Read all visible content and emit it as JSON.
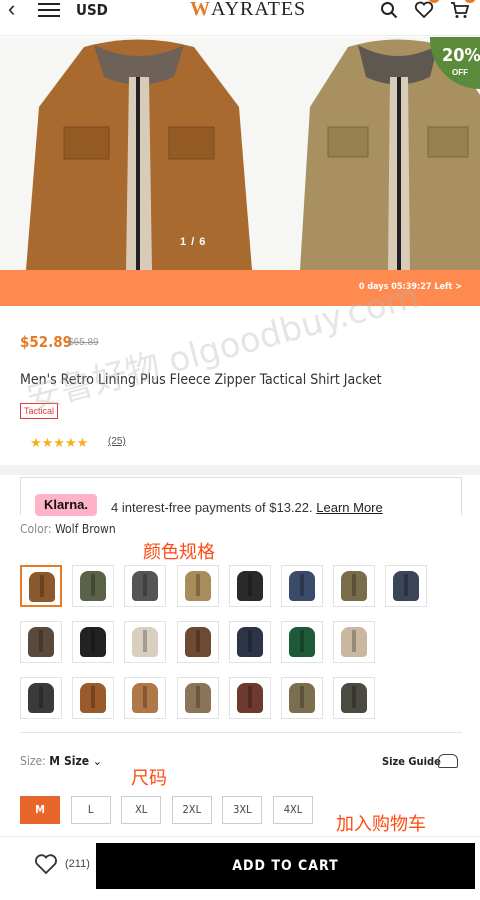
{
  "header": {
    "back_icon": "chevron-left-icon",
    "menu_icon": "hamburger-icon",
    "currency": "USD",
    "logo_text": "AYRATES",
    "logo_initial": "W",
    "icons": [
      "search-icon",
      "heart-icon",
      "cart-icon"
    ]
  },
  "hero": {
    "counter": "1 / 6",
    "discount_pct": "20%",
    "discount_off": "OFF",
    "timer": "0 days 05:39:27 Left  >"
  },
  "product": {
    "price": "$52.89",
    "original_price": "$65.89",
    "title": "Men's Retro Lining Plus Fleece Zipper Tactical Shirt Jacket",
    "tag": "Tactical",
    "rating_stars": 4.5,
    "stars_text": "★★★★★",
    "reviews": "(25)"
  },
  "klarna": {
    "logo": "Klarna.",
    "text": "4 interest-free payments of $13.22.",
    "learn_more": "Learn More"
  },
  "color": {
    "label": "Color:",
    "selected": "Wolf Brown",
    "annotation": "颜色规格",
    "swatches": [
      "#8a5a2e",
      "#5a6348",
      "#555555",
      "#a88c5c",
      "#2a2a2a",
      "#3c4a6a",
      "#7a6e4a",
      "#3a4558",
      "#5a4a3e",
      "#222222",
      "#d8cfc0",
      "#6e4a32",
      "#2e3448",
      "#1f5a38",
      "#c8b8a0",
      "#3a3a3a",
      "#9a5a2a",
      "#b07848",
      "#8c7458",
      "#6e3a2e",
      "#7a7050",
      "#4a4a40"
    ]
  },
  "size": {
    "label": "Size:",
    "selected": "M",
    "dropdown": "Size",
    "guide": "Size Guide",
    "annotation": "尺码",
    "options": [
      "M",
      "L",
      "XL",
      "2XL",
      "3XL",
      "4XL"
    ]
  },
  "cart": {
    "annotation": "加入购物车",
    "wishlist_count": "(211)",
    "button": "ADD TO CART"
  },
  "watermark": "安鲁好物 olgoodbuy.com"
}
